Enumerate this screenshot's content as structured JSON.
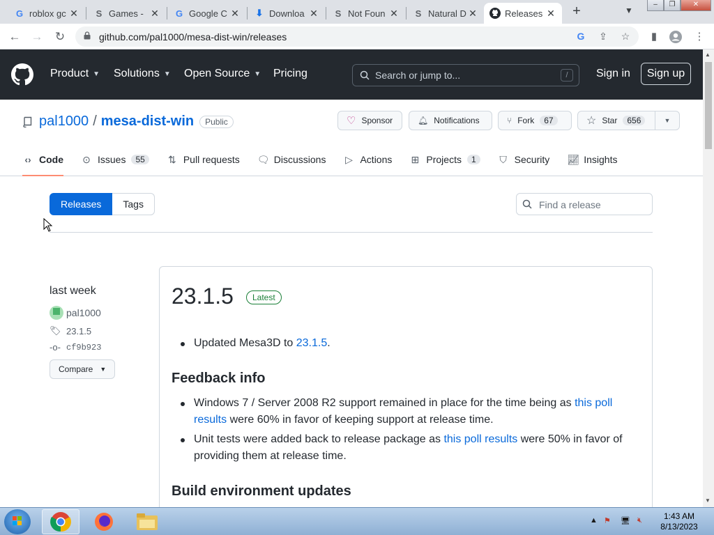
{
  "browser": {
    "tabs": [
      {
        "icon": "google-icon",
        "title": "roblox gc"
      },
      {
        "icon": "stripe-s-icon",
        "title": "Games -"
      },
      {
        "icon": "google-icon",
        "title": "Google C"
      },
      {
        "icon": "download-icon",
        "title": "Downloa"
      },
      {
        "icon": "stripe-s-icon",
        "title": "Not Foun"
      },
      {
        "icon": "stripe-s-icon",
        "title": "Natural D"
      },
      {
        "icon": "github-icon",
        "title": "Releases"
      }
    ],
    "url": "github.com/pal1000/mesa-dist-win/releases"
  },
  "gh_header": {
    "nav": [
      "Product",
      "Solutions",
      "Open Source",
      "Pricing"
    ],
    "search_placeholder": "Search or jump to...",
    "search_key": "/",
    "signin": "Sign in",
    "signup": "Sign up"
  },
  "repo": {
    "owner": "pal1000",
    "separator": "/",
    "name": "mesa-dist-win",
    "visibility": "Public",
    "sponsor": "Sponsor",
    "notifications": "Notifications",
    "fork": "Fork",
    "fork_count": "67",
    "star": "Star",
    "star_count": "656",
    "tabs": [
      {
        "label": "Code",
        "count": ""
      },
      {
        "label": "Issues",
        "count": "55"
      },
      {
        "label": "Pull requests",
        "count": ""
      },
      {
        "label": "Discussions",
        "count": ""
      },
      {
        "label": "Actions",
        "count": ""
      },
      {
        "label": "Projects",
        "count": "1"
      },
      {
        "label": "Security",
        "count": ""
      },
      {
        "label": "Insights",
        "count": ""
      }
    ]
  },
  "subnav": {
    "releases": "Releases",
    "tags": "Tags",
    "find_placeholder": "Find a release"
  },
  "release": {
    "when": "last week",
    "author": "pal1000",
    "tag": "23.1.5",
    "commit": "cf9b923",
    "compare": "Compare",
    "title": "23.1.5",
    "badge": "Latest",
    "bullet1_text": "Updated Mesa3D to ",
    "bullet1_link": "23.1.5",
    "bullet1_end": ".",
    "heading1": "Feedback info",
    "fb1_text": "Windows 7 / Server 2008 R2 support remained in place for the time being as ",
    "fb1_link": "this poll results",
    "fb1_end": " were 60% in favor of keeping support at release time.",
    "fb2_text": "Unit tests were added back to release package as ",
    "fb2_link": "this poll results",
    "fb2_end": " were 50% in favor of providing them at release time.",
    "heading2": "Build environment updates"
  },
  "taskbar": {
    "time": "1:43 AM",
    "date": "8/13/2023"
  },
  "colors": {
    "github_header": "#24292f",
    "link": "#0969da",
    "primary_button": "#0969da",
    "latest_badge": "#1a7f37",
    "active_tab_underline": "#fd8c73"
  }
}
